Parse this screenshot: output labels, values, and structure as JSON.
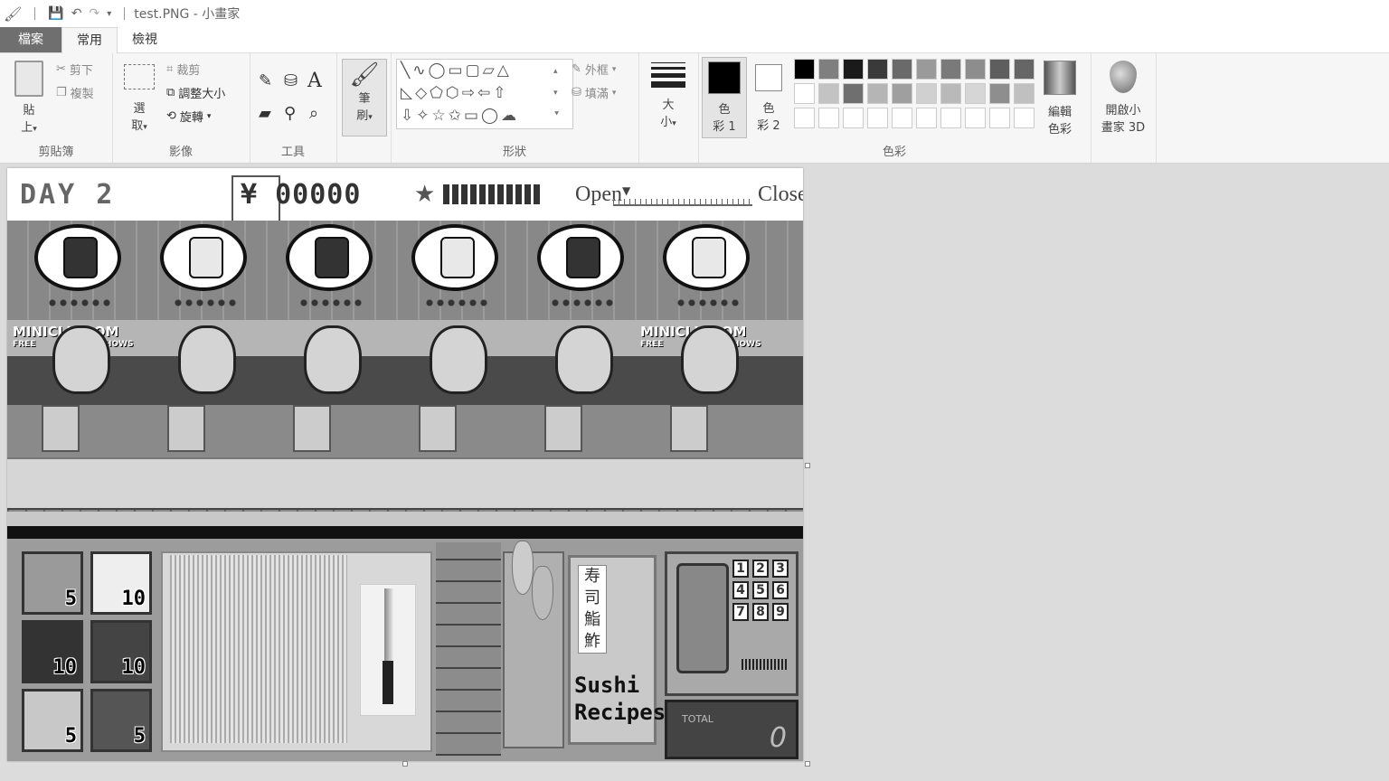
{
  "window": {
    "title": "test.PNG - 小畫家"
  },
  "tabs": [
    {
      "label": "檔案"
    },
    {
      "label": "常用"
    },
    {
      "label": "檢視"
    }
  ],
  "ribbon": {
    "clipboard": {
      "group": "剪貼簿",
      "paste": "貼",
      "paste2": "上",
      "cut": "剪下",
      "copy": "複製"
    },
    "image": {
      "group": "影像",
      "select": "選",
      "select2": "取",
      "crop": "裁剪",
      "resize": "調整大小",
      "rotate": "旋轉"
    },
    "tools": {
      "group": "工具",
      "text_tool": "A"
    },
    "brush": {
      "label": "筆",
      "label2": "刷"
    },
    "shapes": {
      "group": "形狀",
      "outline": "外框",
      "fill": "填滿"
    },
    "size": {
      "label": "大",
      "label2": "小"
    },
    "colors": {
      "group": "色彩",
      "color1": "色",
      "color1b": "彩 1",
      "color2": "色",
      "color2b": "彩 2",
      "edit": "編輯",
      "edit2": "色彩",
      "palette_row1": [
        "#000000",
        "#7f7f7f",
        "#1a1a1a",
        "#3a3a3a",
        "#6a6a6a",
        "#9a9a9a",
        "#7a7a7a",
        "#8d8d8d",
        "#5e5e5e",
        "#666666"
      ],
      "palette_row2": [
        "#ffffff",
        "#c3c3c3",
        "#6f6f6f",
        "#b5b5b5",
        "#9f9f9f",
        "#d0d0d0",
        "#b9b9b9",
        "#d6d6d6",
        "#8e8e8e",
        "#c0c0c0"
      ]
    },
    "paint3d": {
      "label": "開啟小",
      "label2": "畫家 3D"
    }
  },
  "game": {
    "day": "DAY 2",
    "money": "¥ 00000",
    "open_label": "Open",
    "close_label": "Close",
    "brand_left": "MINICLIP.COM",
    "brand_right": "MINICLIP.COM",
    "free": "FREE",
    "shows": "SHOWS",
    "ingredients": [
      "5",
      "10",
      "10",
      "10",
      "5",
      "5"
    ],
    "recipes_kanji": [
      "寿",
      "司",
      "鮨",
      "鮓"
    ],
    "recipes_title": "Sushi",
    "recipes_title2": "Recipes",
    "keypad": [
      "1",
      "2",
      "3",
      "4",
      "5",
      "6",
      "7",
      "8",
      "9"
    ],
    "total_label": "TOTAL",
    "total_value": "0"
  }
}
